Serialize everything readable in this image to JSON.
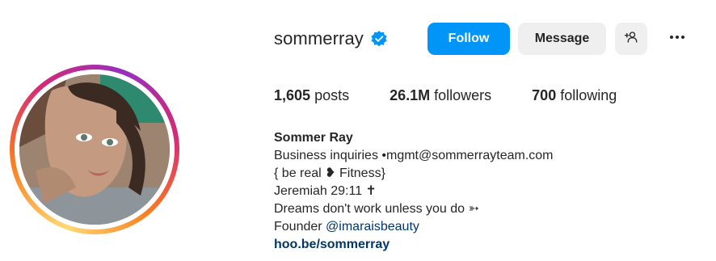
{
  "profile": {
    "username": "sommerray",
    "verified": true,
    "avatar_alt": "profile-photo"
  },
  "actions": {
    "follow": "Follow",
    "message": "Message"
  },
  "stats": {
    "posts_count": "1,605",
    "posts_label": "posts",
    "followers_count": "26.1M",
    "followers_label": "followers",
    "following_count": "700",
    "following_label": "following"
  },
  "bio": {
    "name": "Sommer Ray",
    "line1": "Business inquiries •mgmt@sommerrayteam.com",
    "line2": "{ be real ❥ Fitness}",
    "line3": "Jeremiah 29:11 ✝",
    "line4": "Dreams don't work unless you do ➳",
    "line5_prefix": "Founder ",
    "line5_mention": "@imaraisbeauty",
    "link": "hoo.be/sommerray"
  },
  "colors": {
    "follow_bg": "#0095f6",
    "secondary_bg": "#efefef",
    "link": "#00376b",
    "verified": "#0095f6"
  }
}
